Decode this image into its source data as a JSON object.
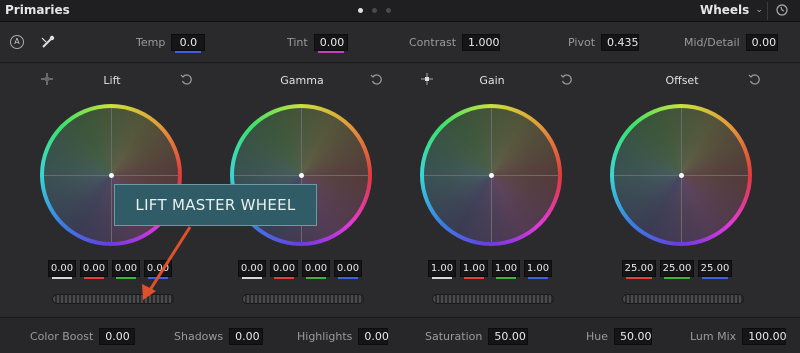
{
  "header": {
    "title": "Primaries",
    "pages": 3,
    "active_page": 1,
    "mode": "Wheels"
  },
  "adjustments": {
    "temp": {
      "label": "Temp",
      "value": "0.0"
    },
    "tint": {
      "label": "Tint",
      "value": "0.00"
    },
    "contrast": {
      "label": "Contrast",
      "value": "1.000"
    },
    "pivot": {
      "label": "Pivot",
      "value": "0.435"
    },
    "mid_detail": {
      "label": "Mid/Detail",
      "value": "0.00"
    }
  },
  "wheels": {
    "lift": {
      "label": "Lift",
      "values": [
        "0.00",
        "0.00",
        "0.00",
        "0.00"
      ]
    },
    "gamma": {
      "label": "Gamma",
      "values": [
        "0.00",
        "0.00",
        "0.00",
        "0.00"
      ]
    },
    "gain": {
      "label": "Gain",
      "values": [
        "1.00",
        "1.00",
        "1.00",
        "1.00"
      ]
    },
    "offset": {
      "label": "Offset",
      "values": [
        "25.00",
        "25.00",
        "25.00"
      ]
    }
  },
  "callout": {
    "text": "LIFT MASTER WHEEL"
  },
  "bottom": {
    "color_boost": {
      "label": "Color Boost",
      "value": "0.00"
    },
    "shadows": {
      "label": "Shadows",
      "value": "0.00"
    },
    "highlights": {
      "label": "Highlights",
      "value": "0.00"
    },
    "saturation": {
      "label": "Saturation",
      "value": "50.00"
    },
    "hue": {
      "label": "Hue",
      "value": "50.00"
    },
    "lum_mix": {
      "label": "Lum Mix",
      "value": "100.00"
    }
  },
  "colors": {
    "y_channel": "#d8d8d8",
    "red": "#e04040",
    "green": "#40b040",
    "blue": "#4060e0",
    "callout_bg": "#2f5c66",
    "arrow": "#e0502a"
  },
  "icons": {
    "auto_balance": "a-circle-icon",
    "picker": "color-picker-icon",
    "reset": "reset-icon",
    "wheel_pick": "crosshair-icon"
  }
}
